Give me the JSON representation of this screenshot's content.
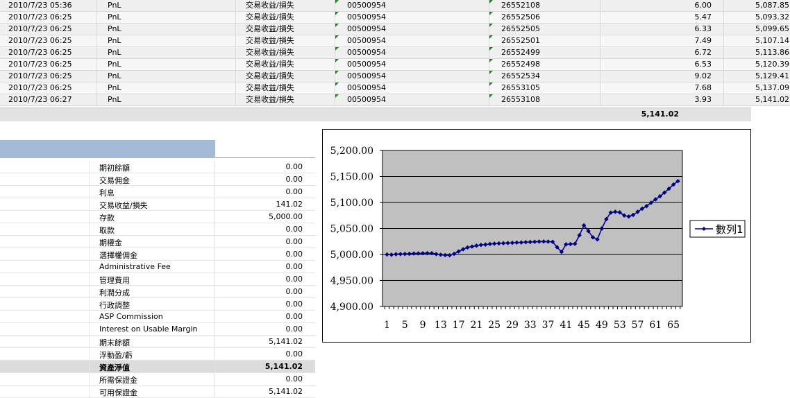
{
  "transactions": [
    {
      "date": "2010/7/23 05:36",
      "type": "PnL",
      "desc": "交易收益/損失",
      "account": "00500954",
      "ticket": "26552108",
      "amount": "6.00",
      "balance": "5,087.85"
    },
    {
      "date": "2010/7/23 06:25",
      "type": "PnL",
      "desc": "交易收益/損失",
      "account": "00500954",
      "ticket": "26552506",
      "amount": "5.47",
      "balance": "5,093.32"
    },
    {
      "date": "2010/7/23 06:25",
      "type": "PnL",
      "desc": "交易收益/損失",
      "account": "00500954",
      "ticket": "26552505",
      "amount": "6.33",
      "balance": "5,099.65"
    },
    {
      "date": "2010/7/23 06:25",
      "type": "PnL",
      "desc": "交易收益/損失",
      "account": "00500954",
      "ticket": "26552501",
      "amount": "7.49",
      "balance": "5,107.14"
    },
    {
      "date": "2010/7/23 06:25",
      "type": "PnL",
      "desc": "交易收益/損失",
      "account": "00500954",
      "ticket": "26552499",
      "amount": "6.72",
      "balance": "5,113.86"
    },
    {
      "date": "2010/7/23 06:25",
      "type": "PnL",
      "desc": "交易收益/損失",
      "account": "00500954",
      "ticket": "26552498",
      "amount": "6.53",
      "balance": "5,120.39"
    },
    {
      "date": "2010/7/23 06:25",
      "type": "PnL",
      "desc": "交易收益/損失",
      "account": "00500954",
      "ticket": "26552534",
      "amount": "9.02",
      "balance": "5,129.41"
    },
    {
      "date": "2010/7/23 06:25",
      "type": "PnL",
      "desc": "交易收益/損失",
      "account": "00500954",
      "ticket": "26553105",
      "amount": "7.68",
      "balance": "5,137.09"
    },
    {
      "date": "2010/7/23 06:27",
      "type": "PnL",
      "desc": "交易收益/損失",
      "account": "00500954",
      "ticket": "26553108",
      "amount": "3.93",
      "balance": "5,141.02"
    }
  ],
  "total_amount": "5,141.02",
  "summary": [
    {
      "label": "期初餘額",
      "value": "0.00",
      "bold": false
    },
    {
      "label": "交易佣金",
      "value": "0.00",
      "bold": false
    },
    {
      "label": "利息",
      "value": "0.00",
      "bold": false
    },
    {
      "label": "交易收益/損失",
      "value": "141.02",
      "bold": false
    },
    {
      "label": "存款",
      "value": "5,000.00",
      "bold": false
    },
    {
      "label": "取款",
      "value": "0.00",
      "bold": false
    },
    {
      "label": "期權金",
      "value": "0.00",
      "bold": false
    },
    {
      "label": "選擇權佣金",
      "value": "0.00",
      "bold": false
    },
    {
      "label": "Administrative Fee",
      "value": "0.00",
      "bold": false
    },
    {
      "label": "管理費用",
      "value": "0.00",
      "bold": false
    },
    {
      "label": "利潤分成",
      "value": "0.00",
      "bold": false
    },
    {
      "label": "行政調整",
      "value": "0.00",
      "bold": false
    },
    {
      "label": "ASP Commission",
      "value": "0.00",
      "bold": false
    },
    {
      "label": "Interest on Usable Margin",
      "value": "0.00",
      "bold": false
    },
    {
      "label": "期末餘額",
      "value": "5,141.02",
      "bold": false
    },
    {
      "label": "浮動盈/虧",
      "value": "0.00",
      "bold": false
    },
    {
      "label": "資產淨值",
      "value": "5,141.02",
      "bold": true
    },
    {
      "label": "所需保證金",
      "value": "0.00",
      "bold": false
    },
    {
      "label": "可用保證金",
      "value": "5,141.02",
      "bold": false
    }
  ],
  "colors": {
    "series": "#000080",
    "plot_bg": "#c0c0c0",
    "header_blue": "#a3bbd6",
    "cell_marker": "#1a8a1a"
  },
  "chart_data": {
    "type": "line",
    "title": "",
    "xlabel": "",
    "ylabel": "",
    "ylim": [
      4900,
      5200
    ],
    "yticks": [
      "5,200.00",
      "5,150.00",
      "5,100.00",
      "5,050.00",
      "5,000.00",
      "4,950.00",
      "4,900.00"
    ],
    "xticks": [
      1,
      5,
      9,
      13,
      17,
      21,
      25,
      29,
      33,
      37,
      41,
      45,
      49,
      53,
      57,
      61,
      65
    ],
    "grid": true,
    "legend_position": "right",
    "series": [
      {
        "name": "數列1",
        "marker": "diamond",
        "values": [
          5000.0,
          4999.5,
          5000.5,
          5000.8,
          5001.0,
          5001.3,
          5001.8,
          5002.0,
          5002.3,
          5002.5,
          5002.4,
          5000.8,
          4999.5,
          4998.8,
          4998.5,
          5001.2,
          5005.8,
          5010.0,
          5013.5,
          5015.2,
          5017.0,
          5018.4,
          5019.0,
          5020.1,
          5020.8,
          5021.3,
          5021.6,
          5022.0,
          5022.4,
          5022.9,
          5023.1,
          5023.6,
          5024.0,
          5024.4,
          5024.8,
          5024.9,
          5024.7,
          5024.3,
          5014.0,
          5005.0,
          5019.5,
          5020.0,
          5020.5,
          5037.0,
          5056.0,
          5045.0,
          5033.0,
          5029.0,
          5050.0,
          5068.0,
          5080.5,
          5082.0,
          5081.0,
          5075.0,
          5073.0,
          5076.0,
          5082.0,
          5088.0,
          5093.0,
          5099.5,
          5106.0,
          5112.0,
          5119.0,
          5126.5,
          5134.5,
          5141.02
        ]
      }
    ]
  }
}
